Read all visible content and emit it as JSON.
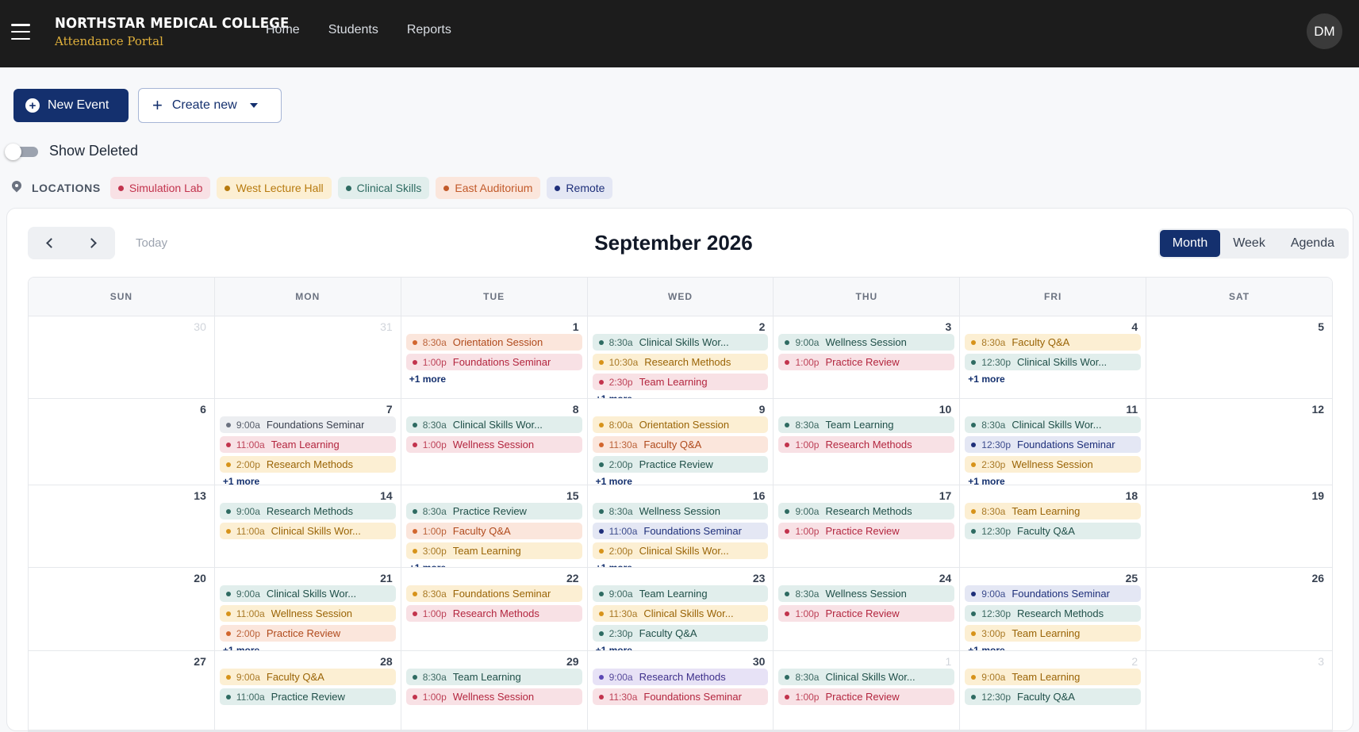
{
  "header": {
    "brand_name": "NORTHSTAR MEDICAL COLLEGE",
    "brand_sub": "Attendance Portal",
    "nav": [
      "Home",
      "Students",
      "Reports"
    ],
    "avatar_initials": "DM"
  },
  "toolbar": {
    "new_event": "New Event",
    "create_new": "Create new"
  },
  "show_deleted": {
    "label": "Show Deleted",
    "on": false
  },
  "locations": {
    "title": "LOCATIONS",
    "items": [
      {
        "label": "Simulation Lab",
        "color": "#c2334d",
        "bg": "#f8e1e5"
      },
      {
        "label": "West Lecture Hall",
        "color": "#b77a0e",
        "bg": "#fcefd3"
      },
      {
        "label": "Clinical Skills",
        "color": "#2e6b62",
        "bg": "#e1eeec"
      },
      {
        "label": "East Auditorium",
        "color": "#c25a2a",
        "bg": "#fbe6dc"
      },
      {
        "label": "Remote",
        "color": "#1e2f7a",
        "bg": "#e4e7f4"
      }
    ]
  },
  "calendar": {
    "today_label": "Today",
    "month_title": "September 2026",
    "views": [
      "Month",
      "Week",
      "Agenda"
    ],
    "active_view": "Month",
    "dow": [
      "SUN",
      "MON",
      "TUE",
      "WED",
      "THU",
      "FRI",
      "SAT"
    ],
    "more_label": "+1 more",
    "weeks": [
      [
        {
          "day": "30",
          "muted": true,
          "events": []
        },
        {
          "day": "31",
          "muted": true,
          "events": []
        },
        {
          "day": "1",
          "events": [
            [
              "8:30a",
              "Orientation Session",
              "east"
            ],
            [
              "1:00p",
              "Foundations Seminar",
              "sim"
            ]
          ],
          "more": true
        },
        {
          "day": "2",
          "events": [
            [
              "8:30a",
              "Clinical Skills Wor...",
              "clin"
            ],
            [
              "10:30a",
              "Research Methods",
              "west"
            ],
            [
              "2:30p",
              "Team Learning",
              "sim"
            ]
          ],
          "more": true
        },
        {
          "day": "3",
          "events": [
            [
              "9:00a",
              "Wellness Session",
              "clin"
            ],
            [
              "1:00p",
              "Practice Review",
              "sim"
            ]
          ]
        },
        {
          "day": "4",
          "events": [
            [
              "8:30a",
              "Faculty Q&A",
              "west"
            ],
            [
              "12:30p",
              "Clinical Skills Wor...",
              "clin"
            ]
          ],
          "more": true
        },
        {
          "day": "5",
          "events": []
        }
      ],
      [
        {
          "day": "6",
          "events": []
        },
        {
          "day": "7",
          "events": [
            [
              "9:00a",
              "Foundations Seminar",
              "gray"
            ],
            [
              "11:00a",
              "Team Learning",
              "sim"
            ],
            [
              "2:00p",
              "Research Methods",
              "west"
            ]
          ],
          "more": true
        },
        {
          "day": "8",
          "events": [
            [
              "8:30a",
              "Clinical Skills Wor...",
              "clin"
            ],
            [
              "1:00p",
              "Wellness Session",
              "sim"
            ]
          ]
        },
        {
          "day": "9",
          "events": [
            [
              "8:00a",
              "Orientation Session",
              "west"
            ],
            [
              "11:30a",
              "Faculty Q&A",
              "east"
            ],
            [
              "2:00p",
              "Practice Review",
              "clin"
            ]
          ],
          "more": true
        },
        {
          "day": "10",
          "events": [
            [
              "8:30a",
              "Team Learning",
              "clin"
            ],
            [
              "1:00p",
              "Research Methods",
              "sim"
            ]
          ]
        },
        {
          "day": "11",
          "events": [
            [
              "8:30a",
              "Clinical Skills Wor...",
              "clin"
            ],
            [
              "12:30p",
              "Foundations Seminar",
              "remote"
            ],
            [
              "2:30p",
              "Wellness Session",
              "west"
            ]
          ],
          "more": true
        },
        {
          "day": "12",
          "events": []
        }
      ],
      [
        {
          "day": "13",
          "events": []
        },
        {
          "day": "14",
          "events": [
            [
              "9:00a",
              "Research Methods",
              "clin"
            ],
            [
              "11:00a",
              "Clinical Skills Wor...",
              "west"
            ]
          ]
        },
        {
          "day": "15",
          "events": [
            [
              "8:30a",
              "Practice Review",
              "clin"
            ],
            [
              "1:00p",
              "Faculty Q&A",
              "east"
            ],
            [
              "3:00p",
              "Team Learning",
              "west"
            ]
          ],
          "more": true
        },
        {
          "day": "16",
          "events": [
            [
              "8:30a",
              "Wellness Session",
              "clin"
            ],
            [
              "11:00a",
              "Foundations Seminar",
              "remote"
            ],
            [
              "2:00p",
              "Clinical Skills Wor...",
              "west"
            ]
          ],
          "more": true
        },
        {
          "day": "17",
          "events": [
            [
              "9:00a",
              "Research Methods",
              "clin"
            ],
            [
              "1:00p",
              "Practice Review",
              "sim"
            ]
          ]
        },
        {
          "day": "18",
          "events": [
            [
              "8:30a",
              "Team Learning",
              "west"
            ],
            [
              "12:30p",
              "Faculty Q&A",
              "clin"
            ]
          ]
        },
        {
          "day": "19",
          "events": []
        }
      ],
      [
        {
          "day": "20",
          "events": []
        },
        {
          "day": "21",
          "events": [
            [
              "9:00a",
              "Clinical Skills Wor...",
              "clin"
            ],
            [
              "11:00a",
              "Wellness Session",
              "west"
            ],
            [
              "2:00p",
              "Practice Review",
              "east"
            ]
          ],
          "more": true
        },
        {
          "day": "22",
          "events": [
            [
              "8:30a",
              "Foundations Seminar",
              "west"
            ],
            [
              "1:00p",
              "Research Methods",
              "sim"
            ]
          ]
        },
        {
          "day": "23",
          "events": [
            [
              "9:00a",
              "Team Learning",
              "clin"
            ],
            [
              "11:30a",
              "Clinical Skills Wor...",
              "west"
            ],
            [
              "2:30p",
              "Faculty Q&A",
              "clin"
            ]
          ],
          "more": true
        },
        {
          "day": "24",
          "events": [
            [
              "8:30a",
              "Wellness Session",
              "clin"
            ],
            [
              "1:00p",
              "Practice Review",
              "sim"
            ]
          ]
        },
        {
          "day": "25",
          "events": [
            [
              "9:00a",
              "Foundations Seminar",
              "remote"
            ],
            [
              "12:30p",
              "Research Methods",
              "clin"
            ],
            [
              "3:00p",
              "Team Learning",
              "west"
            ]
          ],
          "more": true
        },
        {
          "day": "26",
          "events": []
        }
      ],
      [
        {
          "day": "27",
          "events": []
        },
        {
          "day": "28",
          "events": [
            [
              "9:00a",
              "Faculty Q&A",
              "west"
            ],
            [
              "11:00a",
              "Practice Review",
              "clin"
            ]
          ]
        },
        {
          "day": "29",
          "events": [
            [
              "8:30a",
              "Team Learning",
              "clin"
            ],
            [
              "1:00p",
              "Wellness Session",
              "sim"
            ]
          ]
        },
        {
          "day": "30",
          "events": [
            [
              "9:00a",
              "Research Methods",
              "purple"
            ],
            [
              "11:30a",
              "Foundations Seminar",
              "sim"
            ]
          ]
        },
        {
          "day": "1",
          "muted": true,
          "events": [
            [
              "8:30a",
              "Clinical Skills Wor...",
              "clin"
            ],
            [
              "1:00p",
              "Practice Review",
              "sim"
            ]
          ]
        },
        {
          "day": "2",
          "muted": true,
          "events": [
            [
              "9:00a",
              "Team Learning",
              "west"
            ],
            [
              "12:30p",
              "Faculty Q&A",
              "clin"
            ]
          ]
        },
        {
          "day": "3",
          "muted": true,
          "events": []
        }
      ]
    ]
  },
  "event_styles": {
    "sim": {
      "bg": "#f8e1e5",
      "fg": "#b3263f",
      "dot": "#c2334d"
    },
    "west": {
      "bg": "#fcefd3",
      "fg": "#9a6406",
      "dot": "#d7931a"
    },
    "clin": {
      "bg": "#e1eeec",
      "fg": "#1f4f48",
      "dot": "#2e6b62"
    },
    "east": {
      "bg": "#fbe6dc",
      "fg": "#b04a1c",
      "dot": "#d2662e"
    },
    "remote": {
      "bg": "#e4e7f4",
      "fg": "#1e2f7a",
      "dot": "#1e2f7a"
    },
    "gray": {
      "bg": "#eceef1",
      "fg": "#3b4250",
      "dot": "#6b7280"
    },
    "purple": {
      "bg": "#e7e2f6",
      "fg": "#3d2f8a",
      "dot": "#5b48b5"
    }
  }
}
